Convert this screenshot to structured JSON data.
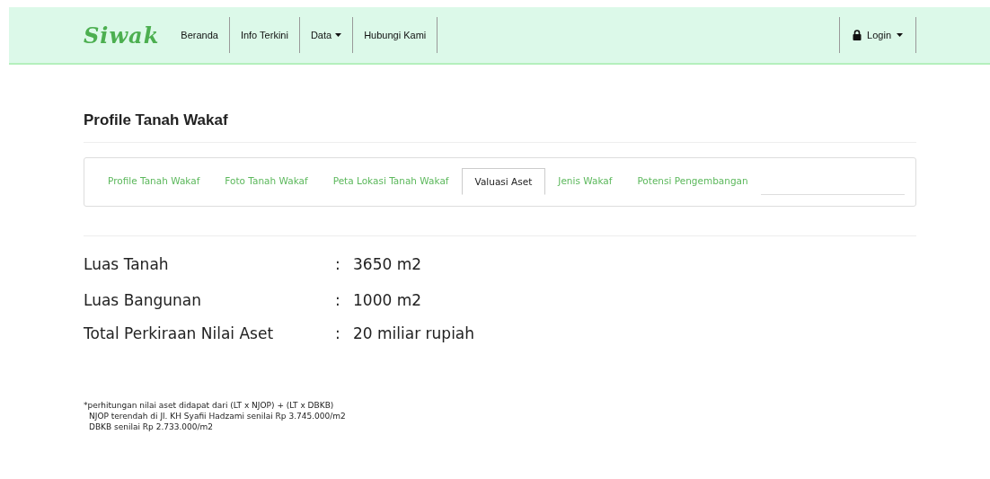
{
  "navbar": {
    "logo": "Siwak",
    "items": [
      {
        "label": "Beranda",
        "dropdown": false
      },
      {
        "label": "Info Terkini",
        "dropdown": false
      },
      {
        "label": "Data",
        "dropdown": true
      },
      {
        "label": "Hubungi Kami",
        "dropdown": false
      }
    ],
    "login": {
      "label": "Login",
      "dropdown": true
    }
  },
  "page_title": "Profile Tanah Wakaf",
  "tabs": [
    {
      "label": "Profile Tanah Wakaf",
      "selected": false
    },
    {
      "label": "Foto Tanah Wakaf",
      "selected": false
    },
    {
      "label": "Peta Lokasi Tanah Wakaf",
      "selected": false
    },
    {
      "label": "Valuasi Aset",
      "selected": true
    },
    {
      "label": "Jenis Wakaf",
      "selected": false
    },
    {
      "label": "Potensi Pengembangan",
      "selected": false
    }
  ],
  "details": [
    {
      "label": "Luas Tanah",
      "separator": ":",
      "value": "3650 m2"
    },
    {
      "label": "Luas Bangunan",
      "separator": ":",
      "value": "1000 m2"
    },
    {
      "label": "Total Perkiraan Nilai Aset",
      "separator": ":",
      "value": "20 miliar rupiah"
    }
  ],
  "notes": [
    "*perhitungan nilai aset didapat dari (LT x NJOP) + (LT x DBKB)",
    "NJOP terendah di Jl. KH Syafii Hadzami senilai Rp 3.745.000/m2",
    "DBKB senilai Rp 2.733.000/m2"
  ]
}
